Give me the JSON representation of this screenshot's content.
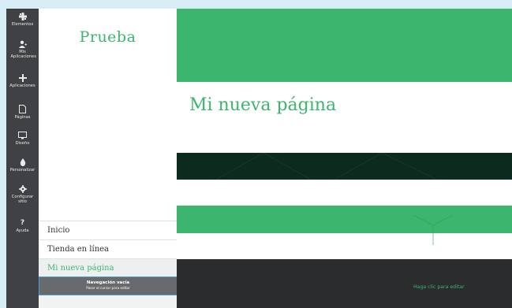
{
  "rail": {
    "items": [
      {
        "label": "Elementos",
        "icon": "puzzle-icon"
      },
      {
        "label": "Mis Aplicaciones",
        "icon": "user-plus-icon"
      },
      {
        "label": "Aplicaciones",
        "icon": "plus-icon"
      },
      {
        "label": "Páginas",
        "icon": "page-icon"
      },
      {
        "label": "Diseño",
        "icon": "monitor-icon"
      },
      {
        "label": "Personalizar",
        "icon": "droplet-icon"
      },
      {
        "label": "Configurar sitio",
        "icon": "gear-icon"
      },
      {
        "label": "Ayuda",
        "icon": "question-icon"
      }
    ]
  },
  "panel": {
    "site_title": "Prueba",
    "nav": [
      "Inicio",
      "Tienda en línea",
      "Mi nueva página"
    ],
    "empty_nav_title": "Navegación vacía",
    "empty_nav_hint": "Pasar el cursor para editar"
  },
  "canvas": {
    "heading": "Mi nueva página",
    "footer_edit": "Haga clic para editar"
  },
  "colors": {
    "accent": "#3cb66e",
    "rail": "#3f4144",
    "dark_band": "#0c2a1e",
    "footer": "#2b2c2e"
  }
}
